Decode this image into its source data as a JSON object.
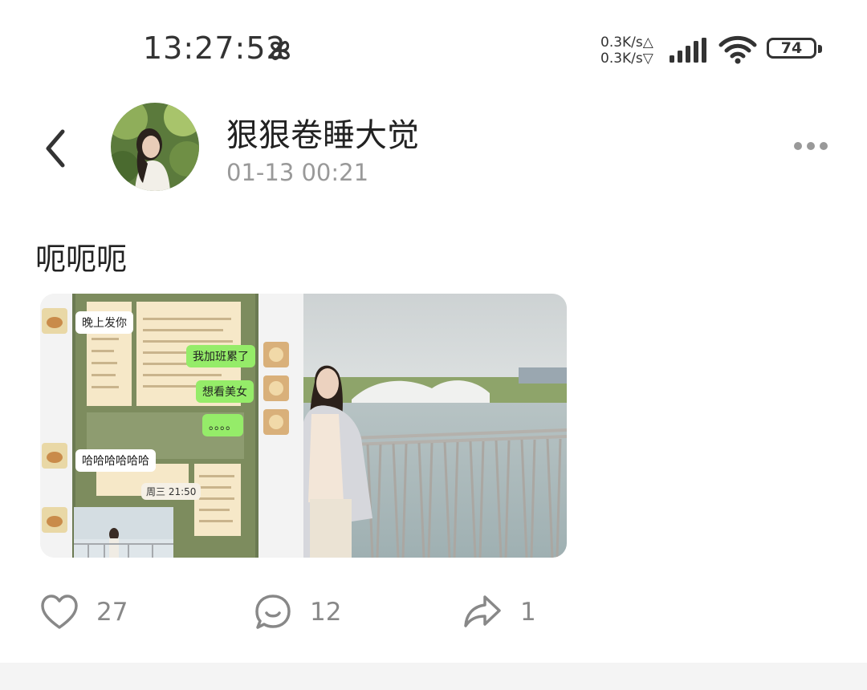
{
  "status_bar": {
    "time": "13:27:52",
    "upload_speed": "0.3K/s",
    "download_speed": "0.3K/s",
    "battery_level": "74",
    "icons": [
      "pinwheel-icon",
      "signal-icon",
      "wifi-icon",
      "battery-icon"
    ]
  },
  "header": {
    "back_icon": "chevron-left-icon",
    "username": "狠狠卷睡大觉",
    "timestamp": "01-13 00:21",
    "more_icon": "more-dots-icon"
  },
  "post": {
    "text": "呃呃呃",
    "photos": {
      "chat_screenshot": {
        "bubbles": [
          "晚上发你",
          "我加班累了",
          "想看美女",
          "。。。。",
          "哈哈哈哈哈哈"
        ],
        "time_label": "周三 21:50"
      }
    }
  },
  "actions": {
    "likes": "27",
    "comments": "12",
    "shares": "1"
  },
  "colors": {
    "accent_green": "#95ec69",
    "text_primary": "#222222",
    "text_secondary": "#999999",
    "icon_gray": "#888888"
  }
}
